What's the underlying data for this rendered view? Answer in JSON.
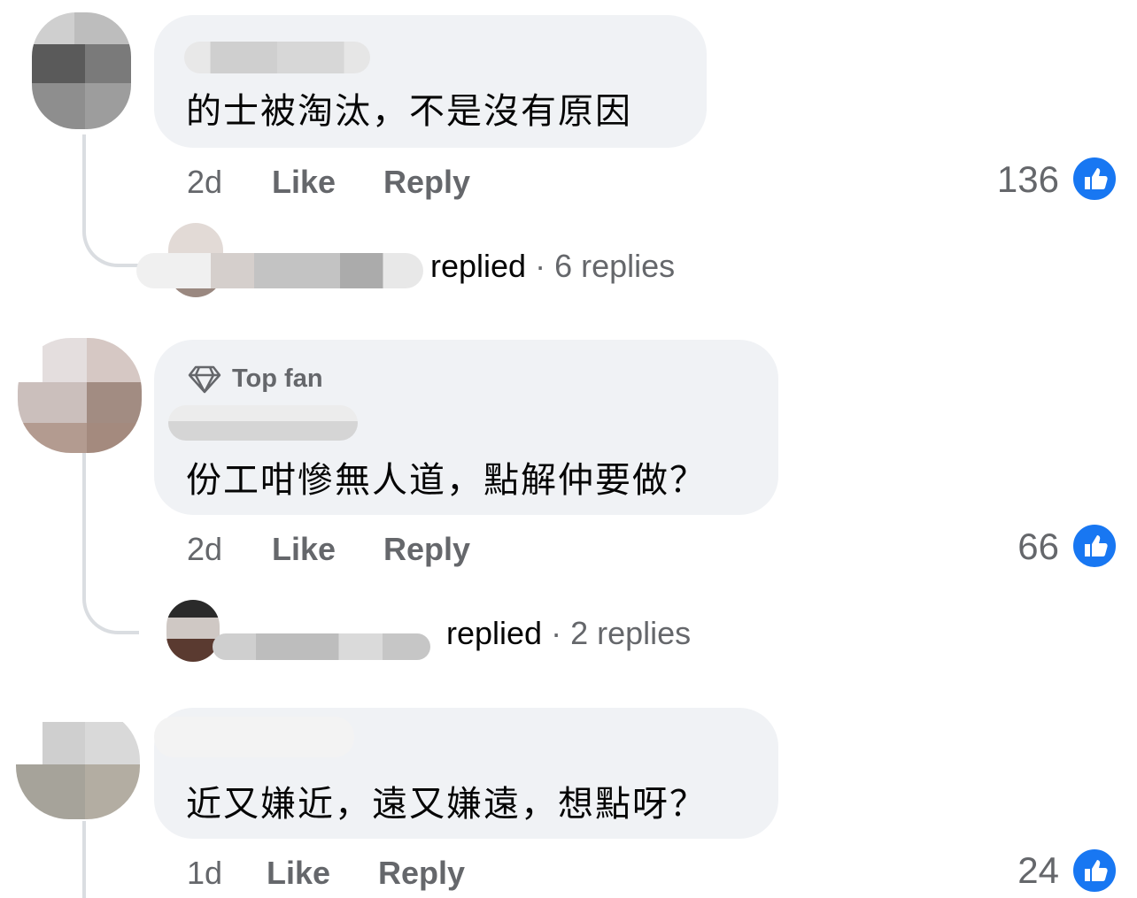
{
  "comments": [
    {
      "text": "的士被淘汰，不是沒有原因",
      "time": "2d",
      "like_label": "Like",
      "reply_label": "Reply",
      "like_count": "136",
      "replies_summary": {
        "action": "replied",
        "separator": "·",
        "count_text": "6 replies"
      }
    },
    {
      "badge": "Top fan",
      "text": "份工咁慘無人道，點解仲要做？",
      "time": "2d",
      "like_label": "Like",
      "reply_label": "Reply",
      "like_count": "66",
      "replies_summary": {
        "action": "replied",
        "separator": "·",
        "count_text": "2 replies"
      }
    },
    {
      "text": "近又嫌近，遠又嫌遠，想點呀？",
      "time": "1d",
      "like_label": "Like",
      "reply_label": "Reply",
      "like_count": "24"
    }
  ],
  "colors": {
    "bubble": "#f0f2f5",
    "meta_text": "#65676b",
    "like_blue": "#1877f2",
    "thread_line": "#dadde1"
  },
  "icons": [
    "thumbs-up-icon",
    "diamond-icon"
  ]
}
